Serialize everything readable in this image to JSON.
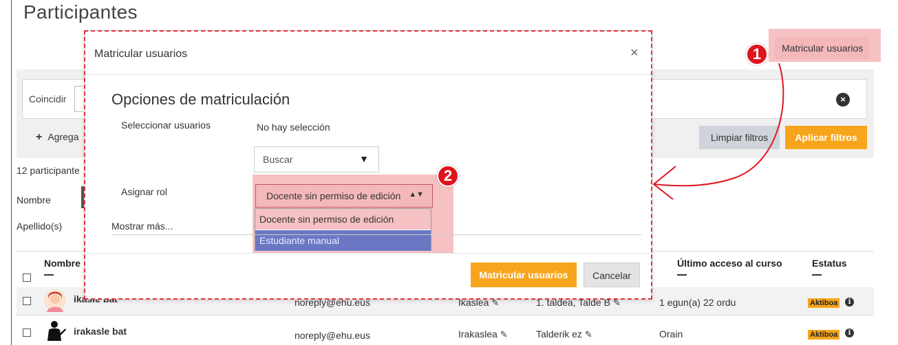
{
  "page": {
    "title": "Participantes"
  },
  "top_button": {
    "label": "Matricular usuarios"
  },
  "filters": {
    "match_label": "Coincidir",
    "add_condition_label": "Agrega",
    "clear_label": "Limpiar filtros",
    "apply_label": "Aplicar filtros",
    "clear_icon": "circle-x-icon"
  },
  "participants": {
    "count_label": "12 participante",
    "first_name_label": "Nombre",
    "last_name_label": "Apellido(s)"
  },
  "table": {
    "headers": {
      "name": "Nombre",
      "last_access": "Último acceso al curso",
      "status": "Estatus"
    },
    "rows": [
      {
        "name": "ikasle bat",
        "email": "noreply@ehu.eus",
        "role": "Ikaslea",
        "group": "1. taldea, Talde B",
        "last_access": "1 egun(a) 22 ordu",
        "status": "Aktiboa",
        "avatar": "female-avatar-icon"
      },
      {
        "name": "irakasle bat",
        "email": "noreply@ehu.eus",
        "role": "Irakaslea",
        "group": "Talderik ez",
        "last_access": "Orain",
        "status": "Aktiboa",
        "avatar": "teacher-avatar-icon"
      }
    ]
  },
  "modal": {
    "title": "Matricular usuarios",
    "close": "×",
    "section_title": "Opciones de matriculación",
    "select_users_label": "Seleccionar usuarios",
    "no_selection": "No hay selección",
    "search_placeholder": "Buscar",
    "assign_role_label": "Asignar rol",
    "role_selected": "Docente sin permiso de edición",
    "role_options": [
      "Docente sin permiso de edición",
      "Estudiante manual"
    ],
    "show_more": "Mostrar más...",
    "enrol_button": "Matricular usuarios",
    "cancel_button": "Cancelar"
  },
  "annotations": {
    "marker_1": "1",
    "marker_2": "2"
  },
  "colors": {
    "accent": "#f7a51c",
    "highlight": "#f6c1c3",
    "marker": "#e0141e",
    "selected_option": "#6a78c4"
  }
}
